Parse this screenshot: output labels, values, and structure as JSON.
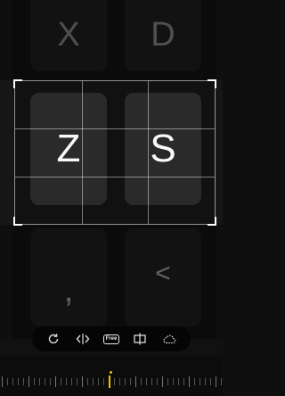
{
  "keyboard": {
    "keys": {
      "x": "X",
      "d": "D",
      "z": "Z",
      "s": "S",
      "comma": ",",
      "back": "<"
    }
  },
  "toolbar": {
    "free_label": "Free",
    "tools": [
      "rotate-icon",
      "flip-horizontal-icon",
      "free-aspect-icon",
      "center-split-icon",
      "cloud-icon"
    ]
  },
  "ruler": {
    "indicator_color": "#f2c200"
  }
}
